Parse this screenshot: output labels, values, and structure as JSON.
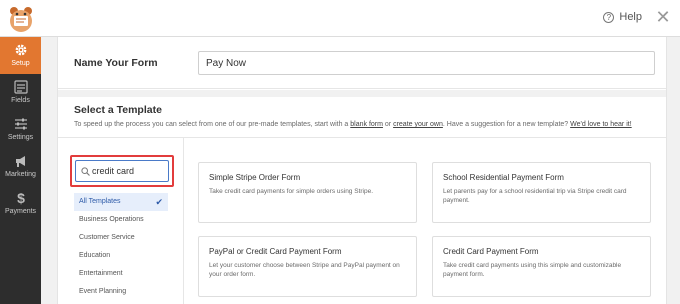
{
  "topbar": {
    "help_label": "Help",
    "close_glyph": "✕",
    "logo_icon": "wpforms-bear-logo-icon"
  },
  "sidebar": {
    "items": [
      {
        "label": "Setup",
        "icon": "gear-icon",
        "active": true
      },
      {
        "label": "Fields",
        "icon": "fields-list-icon",
        "active": false
      },
      {
        "label": "Settings",
        "icon": "sliders-icon",
        "active": false
      },
      {
        "label": "Marketing",
        "icon": "megaphone-icon",
        "active": false
      },
      {
        "label": "Payments",
        "icon": "dollar-icon",
        "active": false
      }
    ]
  },
  "form_name": {
    "label": "Name Your Form",
    "value": "Pay Now"
  },
  "template_section": {
    "title": "Select a Template",
    "desc_pre": "To speed up the process you can select from one of our pre-made templates, start with a ",
    "blank_link": "blank form",
    "desc_mid": " or ",
    "own_link": "create your own",
    "desc_post": ". Have a suggestion for a new template? ",
    "love_link": "We'd love to hear it!"
  },
  "search": {
    "value": "credit card"
  },
  "categories": [
    {
      "label": "All Templates",
      "active": true
    },
    {
      "label": "Business Operations",
      "active": false
    },
    {
      "label": "Customer Service",
      "active": false
    },
    {
      "label": "Education",
      "active": false
    },
    {
      "label": "Entertainment",
      "active": false
    },
    {
      "label": "Event Planning",
      "active": false
    }
  ],
  "templates": [
    {
      "title": "Simple Stripe Order Form",
      "desc": "Take credit card payments for simple orders using Stripe."
    },
    {
      "title": "School Residential Payment Form",
      "desc": "Let parents pay for a school residential trip via Stripe credit card payment."
    },
    {
      "title": "PayPal or Credit Card Payment Form",
      "desc": "Let your customer choose between Stripe and PayPal payment on your order form."
    },
    {
      "title": "Credit Card Payment Form",
      "desc": "Take credit card payments using this simple and customizable payment form."
    }
  ],
  "colors": {
    "accent_orange": "#e27730",
    "sidebar_bg": "#2d2d2d",
    "highlight_red": "#e23c3c",
    "link_blue": "#2d5aa8"
  }
}
